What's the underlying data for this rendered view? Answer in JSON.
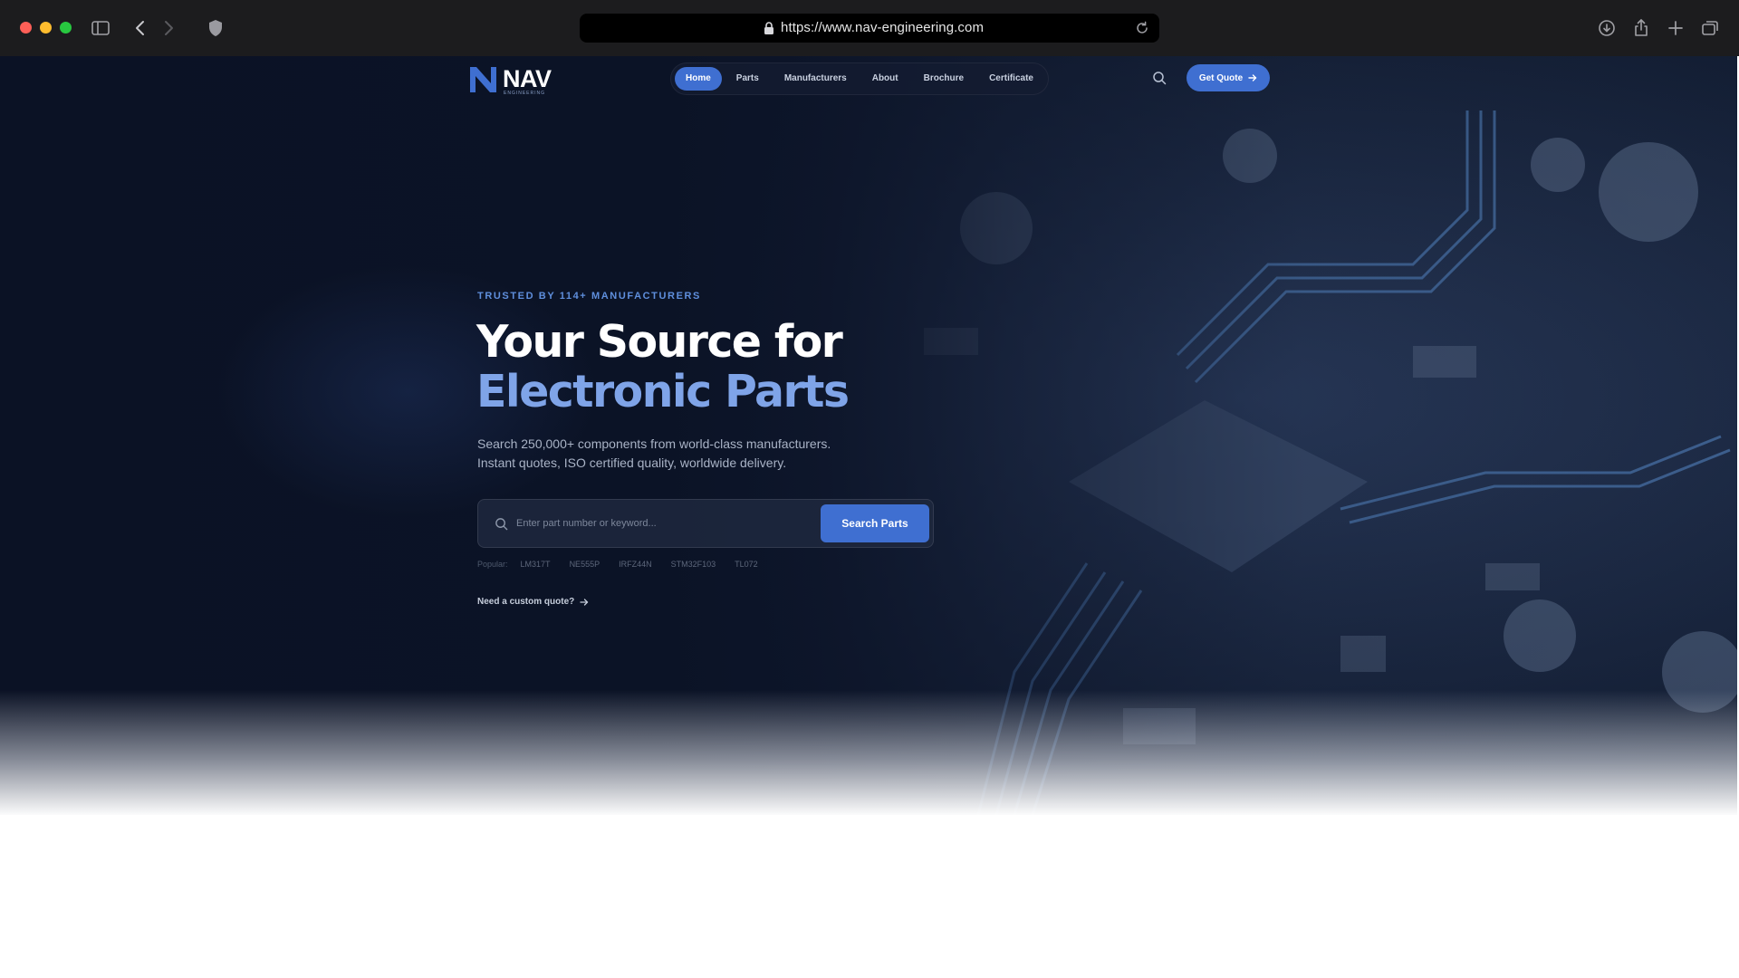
{
  "browser": {
    "url": "https://www.nav-engineering.com"
  },
  "site": {
    "logo_text": "NAV",
    "logo_subtext": "ENGINEERING"
  },
  "nav": {
    "items": [
      "Home",
      "Parts",
      "Manufacturers",
      "About",
      "Brochure",
      "Certificate"
    ],
    "active": "Home",
    "quote_label": "Get Quote"
  },
  "hero": {
    "eyebrow": "TRUSTED BY 114+ MANUFACTURERS",
    "headline_line1": "Your Source for",
    "headline_line2": "Electronic Parts",
    "subtext_line1": "Search 250,000+ components from world-class manufacturers.",
    "subtext_line2": "Instant quotes, ISO certified quality, worldwide delivery.",
    "search_placeholder": "Enter part number or keyword...",
    "search_value": "",
    "search_button": "Search Parts",
    "popular_label": "Popular:",
    "popular_tags": [
      "LM317T",
      "NE555P",
      "IRFZ44N",
      "STM32F103",
      "TL072"
    ],
    "custom_quote_label": "Need a custom quote?"
  },
  "colors": {
    "accent": "#3f6fd1",
    "headline_accent": "#7fa4e8",
    "eyebrow": "#5f8fdd",
    "hero_bg": "#0b1225"
  },
  "icons": {
    "chrome": [
      "sidebar-icon",
      "back-icon",
      "forward-icon",
      "shield-icon",
      "lock-icon",
      "reload-icon",
      "download-icon",
      "share-icon",
      "new-tab-icon",
      "tabs-overview-icon"
    ],
    "page": [
      "search-icon",
      "arrow-right-icon"
    ]
  }
}
